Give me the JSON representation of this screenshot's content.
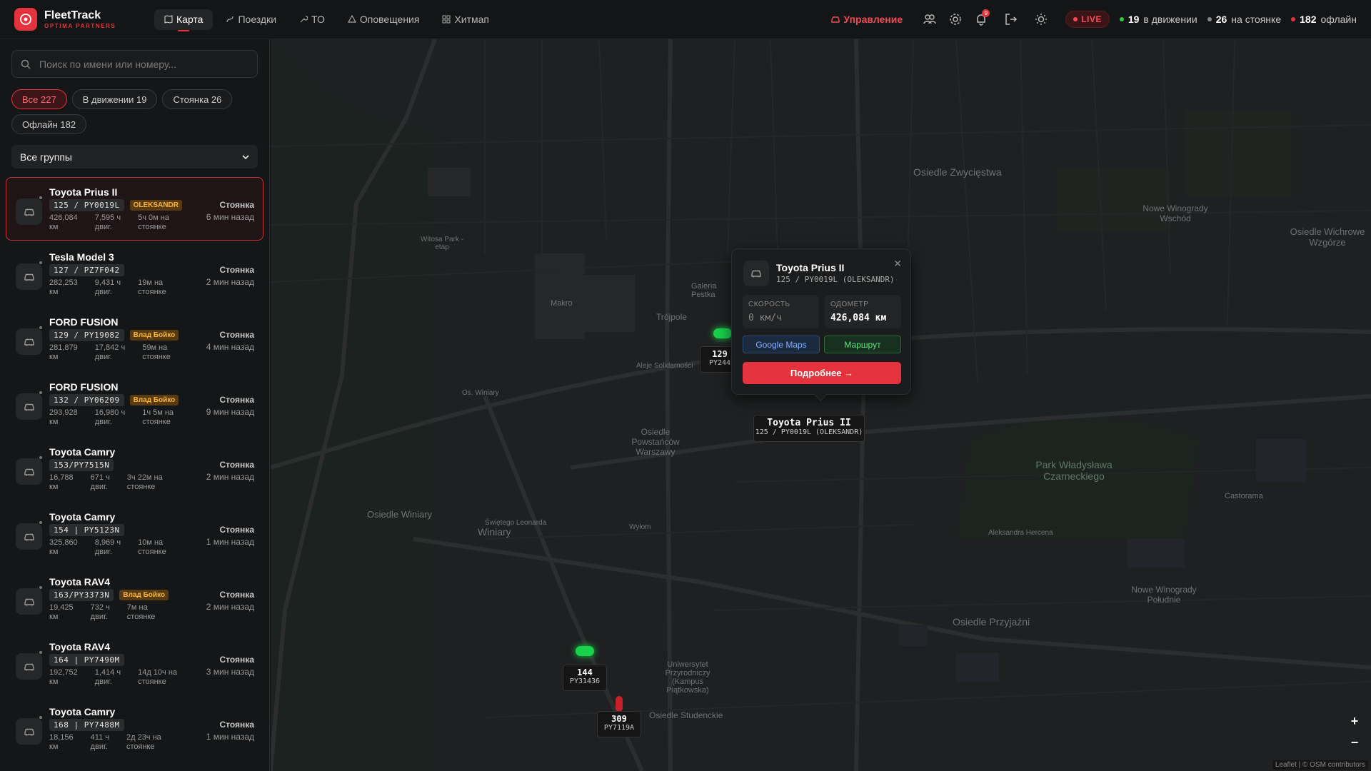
{
  "app": {
    "title": "FleetTrack",
    "subtitle": "OPTIMA PARTNERS",
    "accent": "#e5333d"
  },
  "nav": [
    {
      "label": "Карта",
      "icon": "map-icon",
      "active": true
    },
    {
      "label": "Поездки",
      "icon": "route-icon"
    },
    {
      "label": "ТО",
      "icon": "wrench-icon"
    },
    {
      "label": "Оповещения",
      "icon": "alert-icon"
    },
    {
      "label": "Хитмап",
      "icon": "grid-icon"
    }
  ],
  "header": {
    "manage_label": "Управление",
    "notifications_count": "9",
    "live_label": "LIVE",
    "stats": [
      {
        "count": "19",
        "label": "в движении",
        "color": "#2ecc40"
      },
      {
        "count": "26",
        "label": "на стоянке",
        "color": "#888888"
      },
      {
        "count": "182",
        "label": "офлайн",
        "color": "#e5333d"
      }
    ]
  },
  "sidebar": {
    "search_placeholder": "Поиск по имени или номеру...",
    "filters": [
      {
        "label": "Все 227",
        "active": true
      },
      {
        "label": "В движении 19"
      },
      {
        "label": "Стоянка 26"
      },
      {
        "label": "Офлайн 182"
      }
    ],
    "groups_label": "Все группы",
    "vehicles": [
      {
        "name": "Toyota Prius II",
        "plate": "125 / PY0019L",
        "driver": "OLEKSANDR",
        "km": "426,084",
        "km_unit": "км",
        "hours": "7,595 ч",
        "hours_unit": "двиг.",
        "park": "5ч 0м на",
        "park_unit": "стоянке",
        "status": "Стоянка",
        "ago": "6 мин назад",
        "selected": true
      },
      {
        "name": "Tesla Model 3",
        "plate": "127 / PZ7F042",
        "driver": "",
        "km": "282,253",
        "km_unit": "км",
        "hours": "9,431 ч",
        "hours_unit": "двиг.",
        "park": "19м на",
        "park_unit": "стоянке",
        "status": "Стоянка",
        "ago": "2 мин назад"
      },
      {
        "name": "FORD FUSION",
        "plate": "129 / PY19082",
        "driver": "Влад Бойко",
        "km": "281,879",
        "km_unit": "км",
        "hours": "17,842 ч",
        "hours_unit": "двиг.",
        "park": "59м на",
        "park_unit": "стоянке",
        "status": "Стоянка",
        "ago": "4 мин назад"
      },
      {
        "name": "FORD FUSION",
        "plate": "132 / PY06209",
        "driver": "Влад Бойко",
        "km": "293,928",
        "km_unit": "км",
        "hours": "16,980 ч",
        "hours_unit": "двиг.",
        "park": "1ч 5м на",
        "park_unit": "стоянке",
        "status": "Стоянка",
        "ago": "9 мин назад"
      },
      {
        "name": "Toyota Camry",
        "plate": "153/PY7515N",
        "driver": "",
        "km": "16,788",
        "km_unit": "км",
        "hours": "671 ч",
        "hours_unit": "двиг.",
        "park": "3ч 22м на",
        "park_unit": "стоянке",
        "status": "Стоянка",
        "ago": "2 мин назад"
      },
      {
        "name": "Toyota Camry",
        "plate": "154 | PY5123N",
        "driver": "",
        "km": "325,860",
        "km_unit": "км",
        "hours": "8,969 ч",
        "hours_unit": "двиг.",
        "park": "10м на",
        "park_unit": "стоянке",
        "status": "Стоянка",
        "ago": "1 мин назад"
      },
      {
        "name": "Toyota RAV4",
        "plate": "163/PY3373N",
        "driver": "Влад Бойко",
        "km": "19,425",
        "km_unit": "км",
        "hours": "732 ч",
        "hours_unit": "двиг.",
        "park": "7м на",
        "park_unit": "стоянке",
        "status": "Стоянка",
        "ago": "2 мин назад"
      },
      {
        "name": "Toyota RAV4",
        "plate": "164 | PY7490M",
        "driver": "",
        "km": "192,752",
        "km_unit": "км",
        "hours": "1,414 ч",
        "hours_unit": "двиг.",
        "park": "14д 10ч на",
        "park_unit": "стоянке",
        "status": "Стоянка",
        "ago": "3 мин назад"
      },
      {
        "name": "Toyota Camry",
        "plate": "168 | PY7488M",
        "driver": "",
        "km": "18,156",
        "km_unit": "км",
        "hours": "411 ч",
        "hours_unit": "двиг.",
        "park": "2д 23ч на",
        "park_unit": "стоянке",
        "status": "Стоянка",
        "ago": "1 мин назад"
      }
    ]
  },
  "popup": {
    "title": "Toyota Prius II",
    "subtitle": "125 / PY0019L (OLEKSANDR)",
    "speed_label": "СКОРОСТЬ",
    "speed_value": "0 км/ч",
    "odometer_label": "ОДОМЕТР",
    "odometer_value": "426,084 км",
    "google_label": "Google Maps",
    "route_label": "Маршрут",
    "details_label": "Подробнее →"
  },
  "map": {
    "selected_label_title": "Toyota Prius II",
    "selected_label_sub": "125 / PY0019L (OLEKSANDR)",
    "markers": [
      {
        "num": "129",
        "plate": "PY244"
      },
      {
        "num": "144",
        "plate": "PY31436"
      },
      {
        "num": "309",
        "plate": "PY7119A"
      }
    ],
    "places": [
      "Osiedle Zwycięstwa",
      "Park Władysława Czarneckiego",
      "Osiedle Przyjaźni",
      "Nowe Winogrady Południe",
      "Osiedle Winiary",
      "Winiary",
      "Osiedle Powstańców Warszawy",
      "Trójpole",
      "Makro",
      "Galeria Pestka",
      "Castorama",
      "Os. Winiary",
      "Aleje Solidarności",
      "Aleksandra Hercena",
      "Wyłom",
      "Świętego Leonarda",
      "Nowe Winogrady Wschód",
      "Osiedle Wichrowe Wzgórze",
      "Osiedle Studenckie",
      "Witosa Park - etap",
      "Uniwersytet Przyrodniczy (Kampus Piątkowska)"
    ],
    "zoom_in": "+",
    "zoom_out": "−",
    "attribution": "Leaflet | © OSM contributors"
  }
}
